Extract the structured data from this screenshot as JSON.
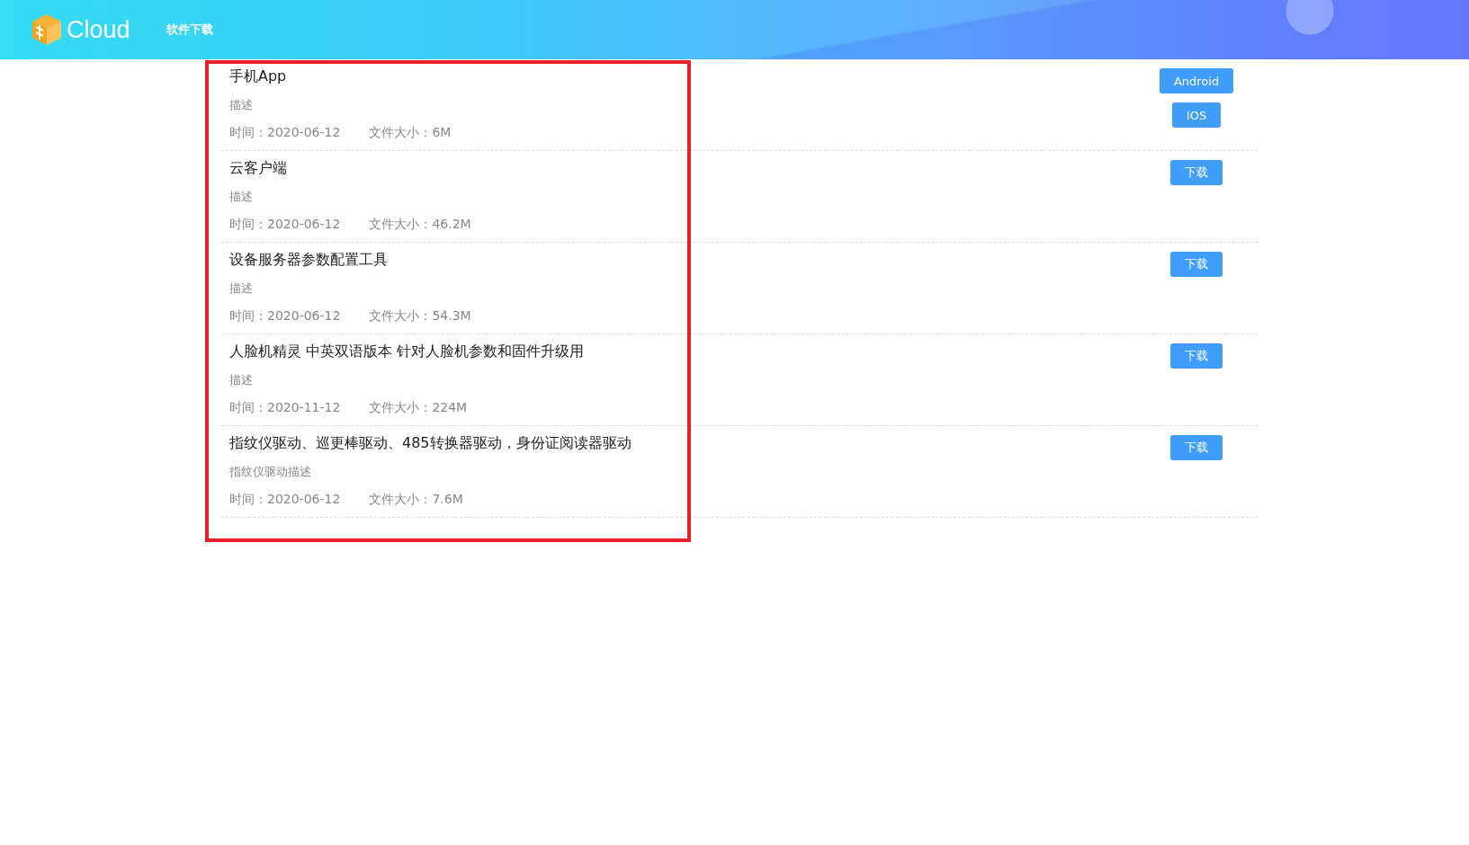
{
  "header": {
    "logo": "Cloud",
    "nav": [
      {
        "label": "软件下载"
      }
    ]
  },
  "downloads": [
    {
      "title": "手机App",
      "description": "描述",
      "time": "时间：2020-06-12",
      "size": "文件大小：6M",
      "buttons": [
        "Android",
        "IOS"
      ]
    },
    {
      "title": "云客户端",
      "description": "描述",
      "time": "时间：2020-06-12",
      "size": "文件大小：46.2M",
      "buttons": [
        "下载"
      ]
    },
    {
      "title": "设备服务器参数配置工具",
      "description": "描述",
      "time": "时间：2020-06-12",
      "size": "文件大小：54.3M",
      "buttons": [
        "下载"
      ]
    },
    {
      "title": "人脸机精灵 中英双语版本 针对人脸机参数和固件升级用",
      "description": "描述",
      "time": "时间：2020-11-12",
      "size": "文件大小：224M",
      "buttons": [
        "下载"
      ]
    },
    {
      "title": "指纹仪驱动、巡更棒驱动、485转换器驱动，身份证阅读器驱动",
      "description": "指纹仪驱动描述",
      "time": "时间：2020-06-12",
      "size": "文件大小：7.6M",
      "buttons": [
        "下载"
      ]
    }
  ]
}
